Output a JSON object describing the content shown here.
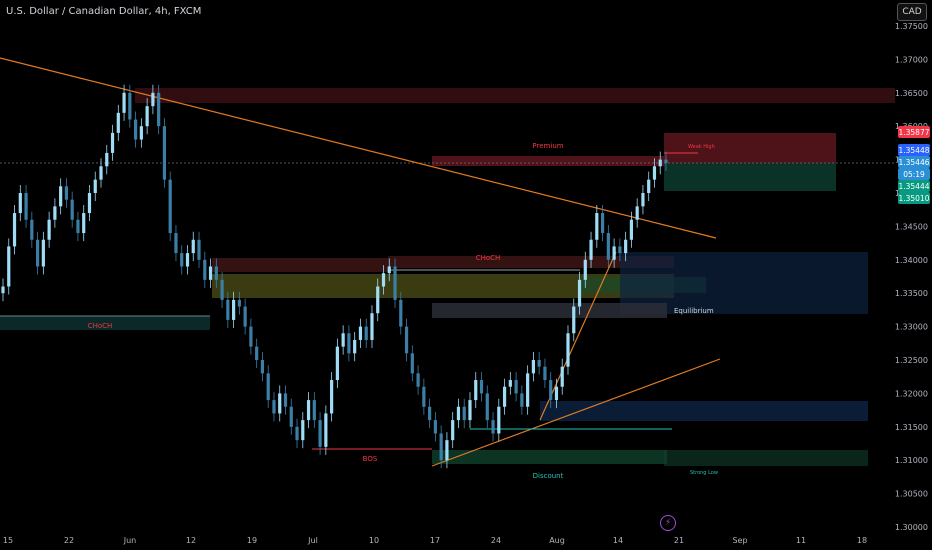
{
  "header": {
    "title": "U.S. Dollar / Canadian Dollar, 4h, FXCM",
    "currency_button": "CAD",
    "flash_icon": "lightning-icon"
  },
  "chart_data": {
    "type": "candlestick",
    "instrument": "U.S. Dollar / Canadian Dollar",
    "timeframe": "4h",
    "source": "FXCM",
    "x_tick_labels": [
      "15",
      "22",
      "Jun",
      "12",
      "19",
      "Jul",
      "10",
      "17",
      "24",
      "Aug",
      "14",
      "21",
      "Sep",
      "11",
      "18"
    ],
    "y_tick_labels": [
      "1.37500",
      "1.37000",
      "1.36500",
      "1.36000",
      "1.35500",
      "1.35000",
      "1.34500",
      "1.34000",
      "1.33500",
      "1.33000",
      "1.32500",
      "1.32000",
      "1.31500",
      "1.31000",
      "1.30500",
      "1.30000"
    ],
    "y_range": [
      1.3,
      1.375
    ],
    "price_labels": [
      {
        "text": "1.35877",
        "color": "#f23645"
      },
      {
        "text": "1.35448",
        "color": "#2962ff"
      },
      {
        "text": "1.35446",
        "color": "#2b8fd6"
      },
      {
        "text": "05:19",
        "color": "#2b8fd6"
      },
      {
        "text": "1.35444",
        "color": "#089981"
      },
      {
        "text": "1.35010",
        "color": "#089981"
      }
    ],
    "annotations": [
      "Premium",
      "Equilibrium",
      "Discount",
      "CHoCH",
      "CHoCH",
      "BOS",
      "Strong Low",
      "Weak High"
    ],
    "close_series": [
      1.336,
      1.342,
      1.347,
      1.35,
      1.346,
      1.343,
      1.339,
      1.343,
      1.346,
      1.348,
      1.351,
      1.349,
      1.346,
      1.344,
      1.347,
      1.35,
      1.352,
      1.354,
      1.356,
      1.359,
      1.362,
      1.365,
      1.361,
      1.358,
      1.36,
      1.363,
      1.365,
      1.36,
      1.352,
      1.344,
      1.341,
      1.339,
      1.341,
      1.343,
      1.34,
      1.337,
      1.339,
      1.337,
      1.334,
      1.331,
      1.334,
      1.333,
      1.33,
      1.327,
      1.325,
      1.323,
      1.319,
      1.317,
      1.32,
      1.318,
      1.315,
      1.313,
      1.316,
      1.319,
      1.316,
      1.312,
      1.317,
      1.322,
      1.327,
      1.329,
      1.326,
      1.328,
      1.33,
      1.328,
      1.332,
      1.336,
      1.338,
      1.339,
      1.334,
      1.33,
      1.326,
      1.323,
      1.321,
      1.318,
      1.316,
      1.314,
      1.31,
      1.313,
      1.316,
      1.318,
      1.316,
      1.319,
      1.322,
      1.32,
      1.316,
      1.314,
      1.318,
      1.321,
      1.322,
      1.32,
      1.318,
      1.323,
      1.325,
      1.324,
      1.322,
      1.319,
      1.321,
      1.324,
      1.329,
      1.333,
      1.337,
      1.34,
      1.343,
      1.347,
      1.344,
      1.34,
      1.342,
      1.341,
      1.343,
      1.346,
      1.348,
      1.35,
      1.352,
      1.354,
      1.355,
      1.3545
    ]
  }
}
